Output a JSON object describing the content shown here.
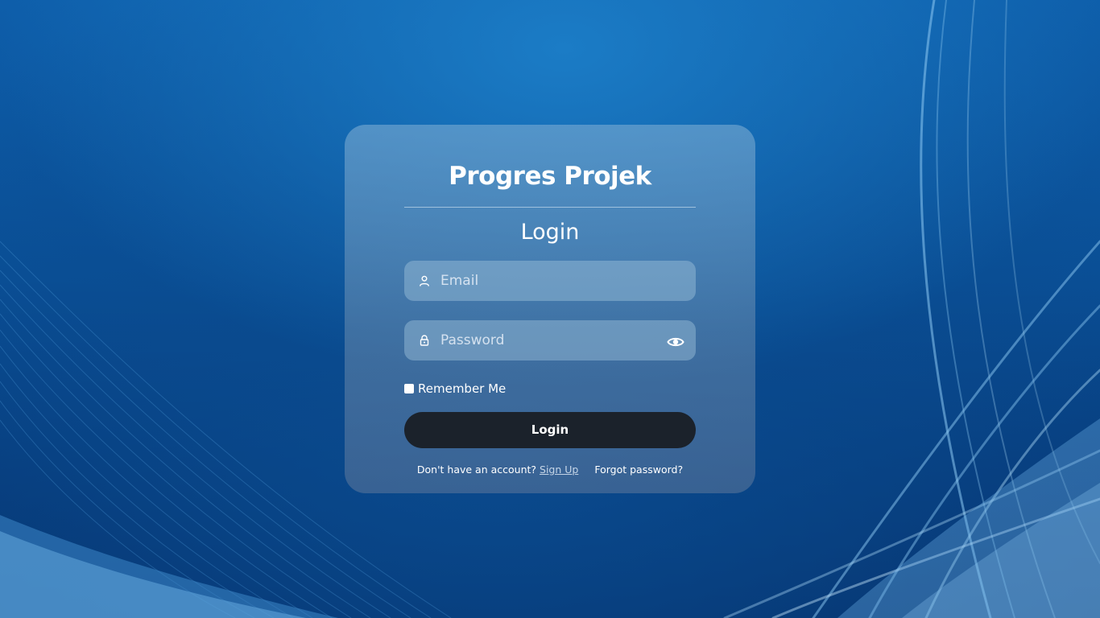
{
  "app": {
    "title": "Progres Projek"
  },
  "login_form": {
    "heading": "Login",
    "email_placeholder": "Email",
    "password_placeholder": "Password",
    "remember_label": "Remember Me",
    "remember_checked": false,
    "submit_label": "Login"
  },
  "footer": {
    "signup_prompt": "Don't have an account? ",
    "signup_link": "Sign Up",
    "forgot_link": "Forgot password?"
  },
  "icons": {
    "email_field": "user-icon",
    "password_field": "lock-icon",
    "password_toggle": "eye-icon"
  },
  "colors": {
    "button": "#1b222b",
    "card": "rgba(120,170,210,0.6)"
  }
}
